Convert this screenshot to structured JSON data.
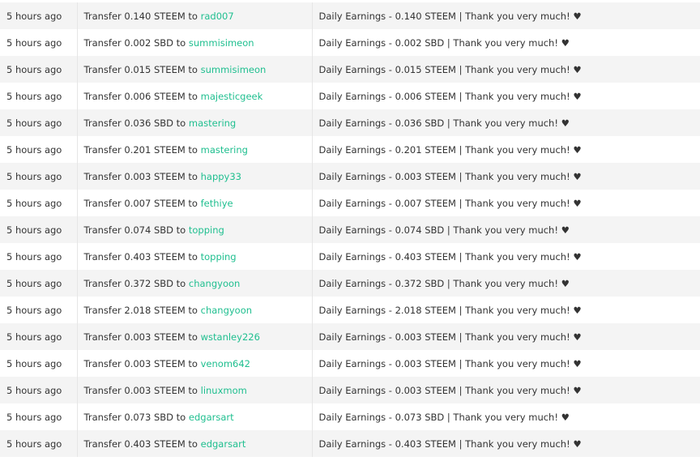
{
  "transfers": [
    {
      "time": "5 hours ago",
      "op_prefix": "Transfer 0.140 STEEM to",
      "recipient": "rad007",
      "memo": "Daily Earnings - 0.140 STEEM | Thank you very much! ♥"
    },
    {
      "time": "5 hours ago",
      "op_prefix": "Transfer 0.002 SBD to",
      "recipient": "summisimeon",
      "memo": "Daily Earnings - 0.002 SBD | Thank you very much! ♥"
    },
    {
      "time": "5 hours ago",
      "op_prefix": "Transfer 0.015 STEEM to",
      "recipient": "summisimeon",
      "memo": "Daily Earnings - 0.015 STEEM | Thank you very much! ♥"
    },
    {
      "time": "5 hours ago",
      "op_prefix": "Transfer 0.006 STEEM to",
      "recipient": "majesticgeek",
      "memo": "Daily Earnings - 0.006 STEEM | Thank you very much! ♥"
    },
    {
      "time": "5 hours ago",
      "op_prefix": "Transfer 0.036 SBD to",
      "recipient": "mastering",
      "memo": "Daily Earnings - 0.036 SBD | Thank you very much! ♥"
    },
    {
      "time": "5 hours ago",
      "op_prefix": "Transfer 0.201 STEEM to",
      "recipient": "mastering",
      "memo": "Daily Earnings - 0.201 STEEM | Thank you very much! ♥"
    },
    {
      "time": "5 hours ago",
      "op_prefix": "Transfer 0.003 STEEM to",
      "recipient": "happy33",
      "memo": "Daily Earnings - 0.003 STEEM | Thank you very much! ♥"
    },
    {
      "time": "5 hours ago",
      "op_prefix": "Transfer 0.007 STEEM to",
      "recipient": "fethiye",
      "memo": "Daily Earnings - 0.007 STEEM | Thank you very much! ♥"
    },
    {
      "time": "5 hours ago",
      "op_prefix": "Transfer 0.074 SBD to",
      "recipient": "topping",
      "memo": "Daily Earnings - 0.074 SBD | Thank you very much! ♥"
    },
    {
      "time": "5 hours ago",
      "op_prefix": "Transfer 0.403 STEEM to",
      "recipient": "topping",
      "memo": "Daily Earnings - 0.403 STEEM | Thank you very much! ♥"
    },
    {
      "time": "5 hours ago",
      "op_prefix": "Transfer 0.372 SBD to",
      "recipient": "changyoon",
      "memo": "Daily Earnings - 0.372 SBD | Thank you very much! ♥"
    },
    {
      "time": "5 hours ago",
      "op_prefix": "Transfer 2.018 STEEM to",
      "recipient": "changyoon",
      "memo": "Daily Earnings - 2.018 STEEM | Thank you very much! ♥"
    },
    {
      "time": "5 hours ago",
      "op_prefix": "Transfer 0.003 STEEM to",
      "recipient": "wstanley226",
      "memo": "Daily Earnings - 0.003 STEEM | Thank you very much! ♥"
    },
    {
      "time": "5 hours ago",
      "op_prefix": "Transfer 0.003 STEEM to",
      "recipient": "venom642",
      "memo": "Daily Earnings - 0.003 STEEM | Thank you very much! ♥"
    },
    {
      "time": "5 hours ago",
      "op_prefix": "Transfer 0.003 STEEM to",
      "recipient": "linuxmom",
      "memo": "Daily Earnings - 0.003 STEEM | Thank you very much! ♥"
    },
    {
      "time": "5 hours ago",
      "op_prefix": "Transfer 0.073 SBD to",
      "recipient": "edgarsart",
      "memo": "Daily Earnings - 0.073 SBD | Thank you very much! ♥"
    },
    {
      "time": "5 hours ago",
      "op_prefix": "Transfer 0.403 STEEM to",
      "recipient": "edgarsart",
      "memo": "Daily Earnings - 0.403 STEEM | Thank you very much! ♥"
    }
  ],
  "colors": {
    "link": "#1fbf8f",
    "text": "#333333",
    "row_stripe": "#f4f4f4"
  }
}
